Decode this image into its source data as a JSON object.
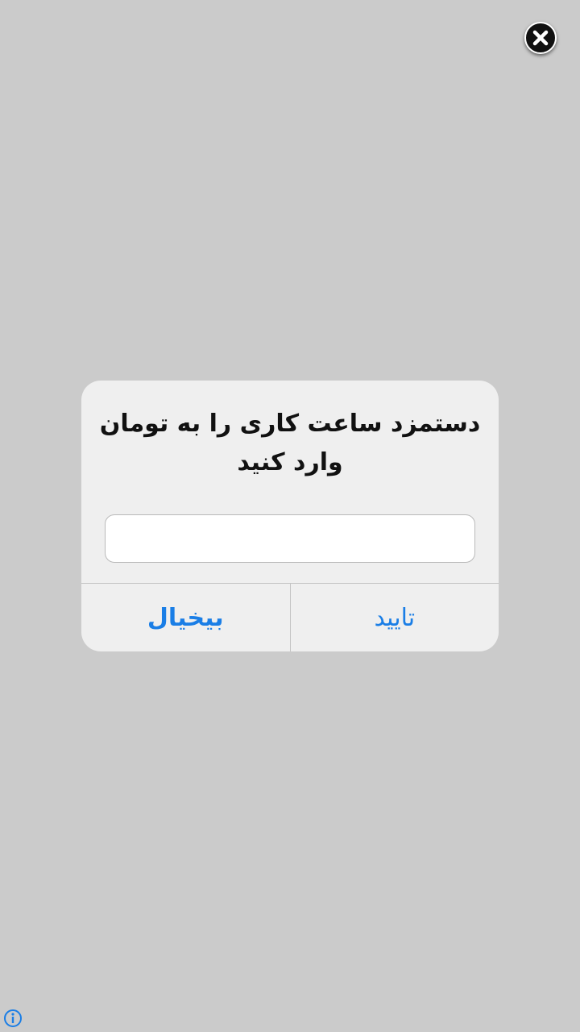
{
  "dialog": {
    "title": "دستمزد ساعت کاری را به تومان وارد کنید",
    "input_value": "",
    "cancel_label": "بیخیال",
    "confirm_label": "تایید"
  },
  "icons": {
    "close": "close-icon",
    "info": "info-icon"
  },
  "colors": {
    "backdrop": "#cbcbcb",
    "dialog_bg": "#efefef",
    "button_text": "#1a7ee6"
  }
}
